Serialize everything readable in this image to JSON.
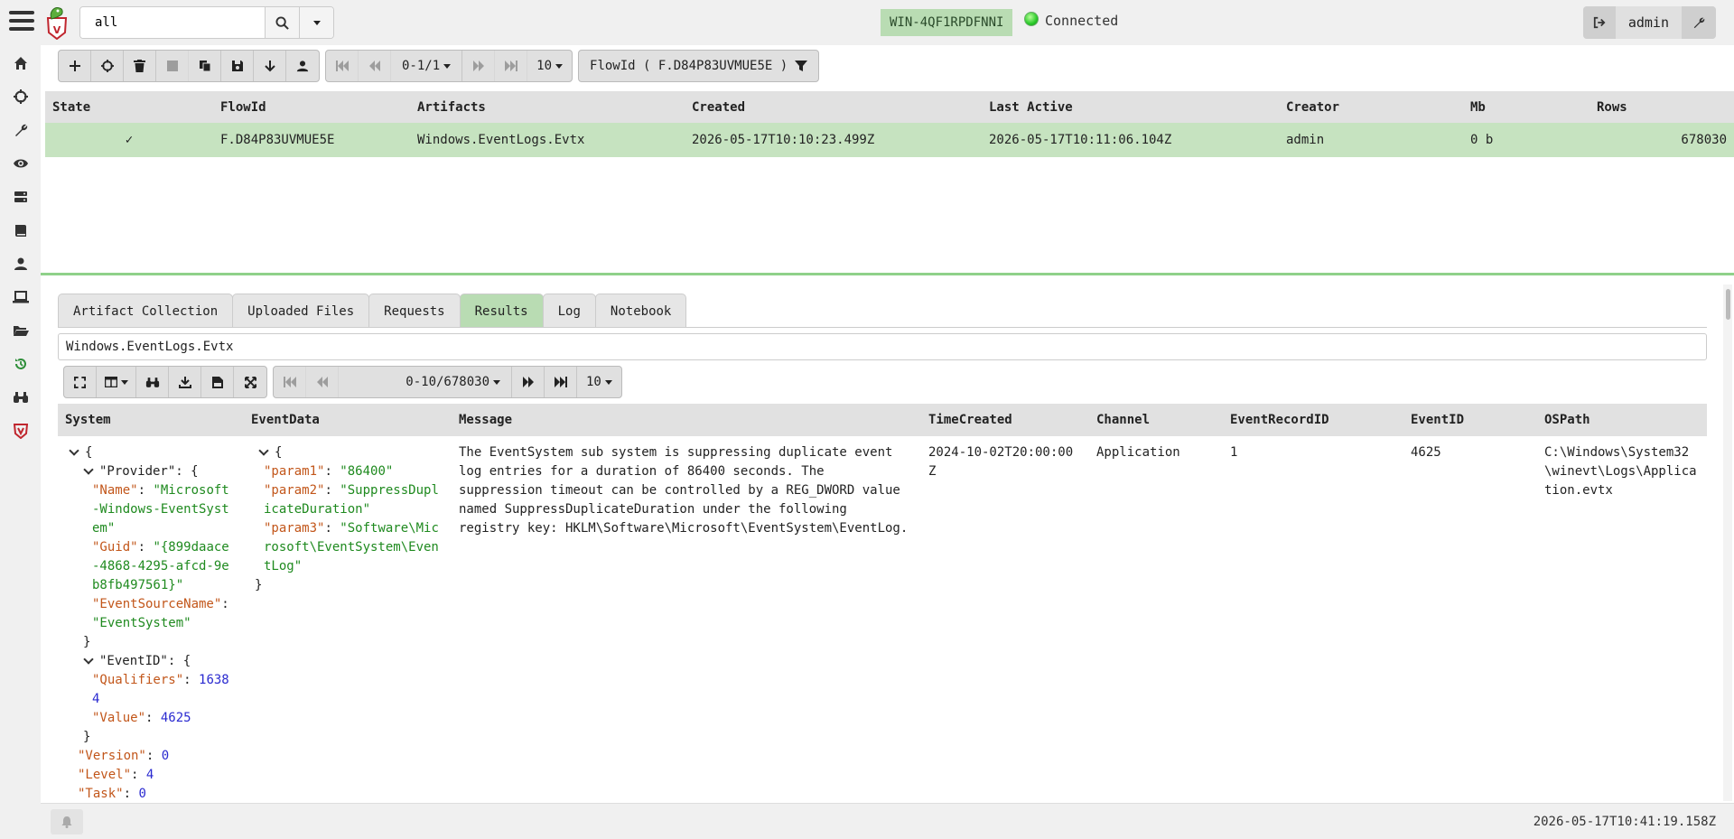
{
  "search": {
    "value": "all"
  },
  "header": {
    "client_id": "WIN-4QF1RPDFNNI",
    "connection_status": "Connected",
    "user": "admin"
  },
  "flow_toolbar": {
    "pagination": "0-1/1",
    "page_size": "10",
    "filter_label": "FlowId ( F.D84P83UVMUE5E )"
  },
  "flows_table": {
    "columns": [
      "State",
      "FlowId",
      "Artifacts",
      "Created",
      "Last Active",
      "Creator",
      "Mb",
      "Rows"
    ],
    "rows": [
      {
        "state": "✓",
        "flow_id": "F.D84P83UVMUE5E",
        "artifacts": "Windows.EventLogs.Evtx",
        "created": "2026-05-17T10:10:23.499Z",
        "last_active": "2026-05-17T10:11:06.104Z",
        "creator": "admin",
        "mb": "0 b",
        "rows": "678030"
      }
    ]
  },
  "tabs": [
    "Artifact Collection",
    "Uploaded Files",
    "Requests",
    "Results",
    "Log",
    "Notebook"
  ],
  "active_tab": "Results",
  "artifact_select": "Windows.EventLogs.Evtx",
  "results_toolbar": {
    "pagination": "0-10/678030",
    "page_size": "10"
  },
  "results_table": {
    "columns": [
      "System",
      "EventData",
      "Message",
      "TimeCreated",
      "Channel",
      "EventRecordID",
      "EventID",
      "OSPath"
    ],
    "row": {
      "message": "The EventSystem sub system is suppressing duplicate event log entries for a duration of 86400 seconds. The suppression timeout can be controlled by a REG_DWORD value named SuppressDuplicateDuration under the following registry key: HKLM\\Software\\Microsoft\\EventSystem\\EventLog.",
      "time_created": "2024-10-02T20:00:00Z",
      "channel": "Application",
      "event_record_id": "1",
      "event_id": "4625",
      "os_path": "C:\\Windows\\System32\\winevt\\Logs\\Application.evtx",
      "system": {
        "brace": "{",
        "close_brace": "}",
        "provider_key": "\"Provider\": {",
        "name_key": "\"Name\"",
        "name_val": "\"Microsoft-Windows-EventSystem\"",
        "guid_key": "\"Guid\"",
        "guid_val": "\"{899daace-4868-4295-afcd-9eb8fb497561}\"",
        "source_key": "\"EventSourceName\"",
        "source_val": "\"EventSystem\"",
        "eventid_key": "\"EventID\": {",
        "qualifiers_key": "\"Qualifiers\"",
        "qualifiers_val": "16384",
        "value_key": "\"Value\"",
        "value_val": "4625",
        "version_key": "\"Version\"",
        "version_val": "0",
        "level_key": "\"Level\"",
        "level_val": "4",
        "task_key": "\"Task\"",
        "task_val": "0"
      },
      "event_data": {
        "brace": "{",
        "close_brace": "}",
        "p1_key": "\"param1\"",
        "p1_val": "\"86400\"",
        "p2_key": "\"param2\"",
        "p2_val": "\"SuppressDuplicateDuration\"",
        "p3_key": "\"param3\"",
        "p3_val": "\"Software\\Microsoft\\EventSystem\\EventLog\""
      }
    }
  },
  "footer": {
    "clock": "2026-05-17T10:41:19.158Z"
  },
  "colors": {
    "active_green": "#b9dcb3",
    "row_green": "#c6e3c0",
    "splitter_green": "#8fd18a",
    "json_key": "#c2561a",
    "json_string": "#1f8a1f",
    "json_number": "#2a2ad0"
  }
}
